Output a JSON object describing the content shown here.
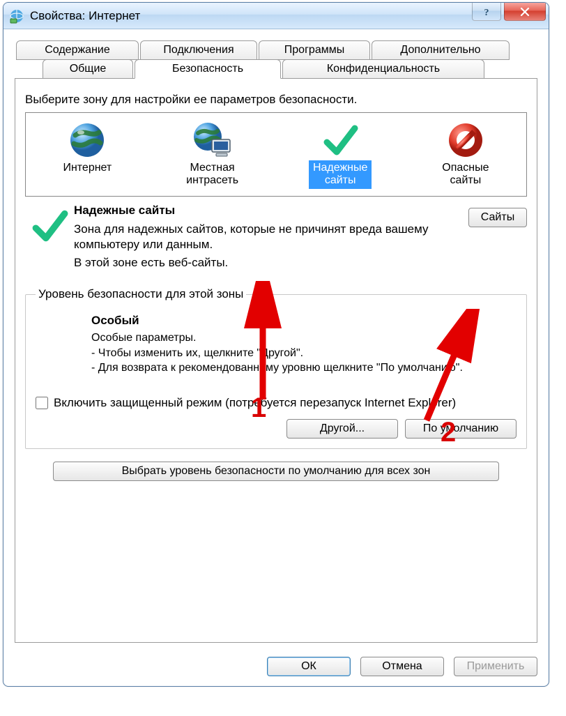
{
  "window_title": "Свойства: Интернет",
  "tabs_row1": [
    "Содержание",
    "Подключения",
    "Программы",
    "Дополнительно"
  ],
  "tabs_row2": [
    "Общие",
    "Безопасность",
    "Конфиденциальность"
  ],
  "active_tab": "Безопасность",
  "zone_instruction": "Выберите зону для настройки ее параметров безопасности.",
  "zones": [
    {
      "label": "Интернет",
      "icon": "globe"
    },
    {
      "label": "Местная\nинтрасеть",
      "icon": "globe-pc"
    },
    {
      "label": "Надежные\nсайты",
      "icon": "check",
      "selected": true
    },
    {
      "label": "Опасные\nсайты",
      "icon": "forbidden"
    }
  ],
  "selected_zone_title": "Надежные сайты",
  "selected_zone_desc": "Зона для надежных сайтов, которые не причинят вреда вашему компьютеру или данным.",
  "selected_zone_note": "В этой зоне есть веб-сайты.",
  "sites_button": "Сайты",
  "group_legend": "Уровень безопасности для этой зоны",
  "level_name": "Особый",
  "level_line1": "Особые параметры.",
  "level_line2": "- Чтобы изменить их, щелкните \"Другой\".",
  "level_line3": "- Для возврата к рекомендованному уровню щелкните \"По умолчанию\".",
  "protected_mode_label": "Включить защищенный режим (потребуется перезапуск Internet Explorer)",
  "protected_mode_checked": false,
  "button_other": "Другой...",
  "button_default": "По умолчанию",
  "button_reset_all": "Выбрать уровень безопасности по умолчанию для всех зон",
  "button_ok": "ОК",
  "button_cancel": "Отмена",
  "button_apply": "Применить",
  "annotations": {
    "arrow1_label": "1",
    "arrow2_label": "2"
  }
}
